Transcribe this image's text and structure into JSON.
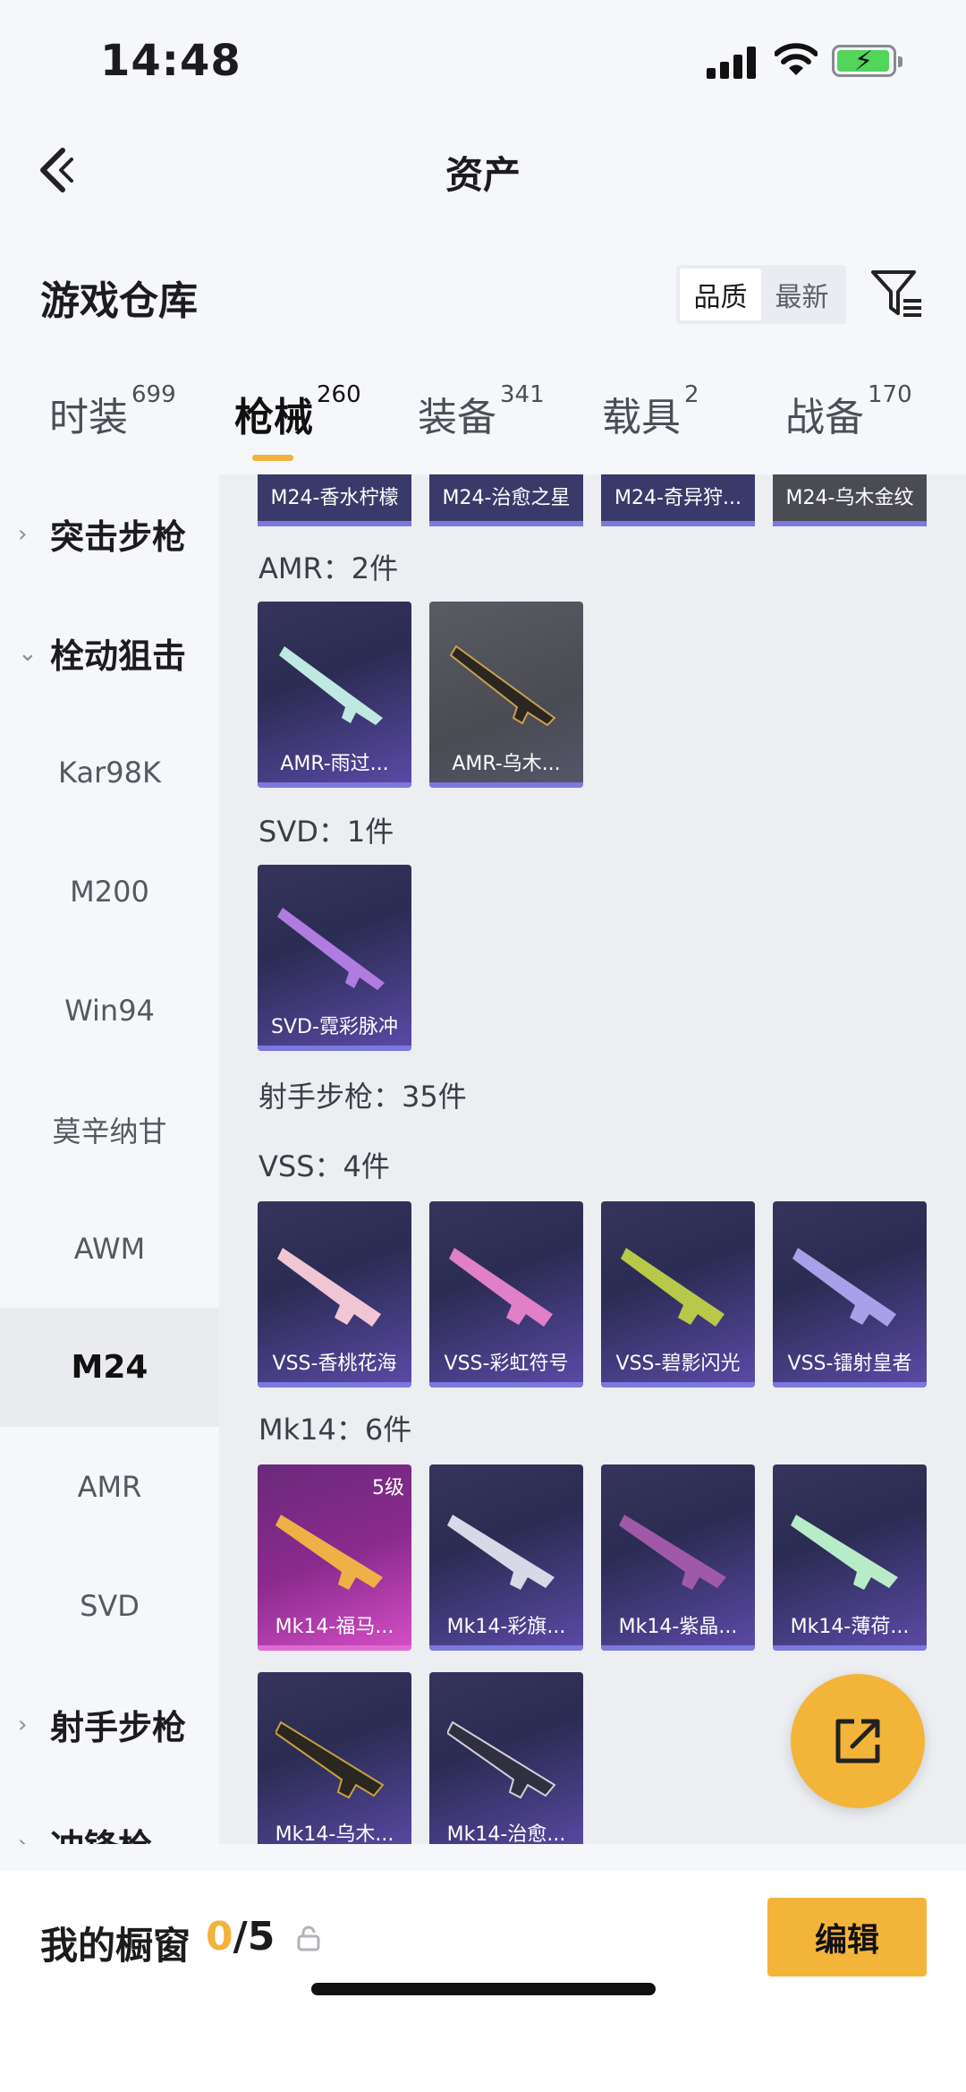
{
  "status_bar": {
    "time": "14:48"
  },
  "nav": {
    "title": "资产"
  },
  "header": {
    "title": "游戏仓库",
    "sort_options": [
      "品质",
      "最新"
    ],
    "sort_active": "品质"
  },
  "tabs": [
    {
      "label": "时装",
      "count": "699"
    },
    {
      "label": "枪械",
      "count": "260",
      "active": true
    },
    {
      "label": "装备",
      "count": "341"
    },
    {
      "label": "载具",
      "count": "2"
    },
    {
      "label": "战备",
      "count": "170"
    }
  ],
  "sidebar": {
    "items": [
      {
        "label": "突击步枪",
        "type": "group",
        "expanded": false
      },
      {
        "label": "栓动狙击",
        "type": "group",
        "expanded": true
      },
      {
        "label": "Kar98K"
      },
      {
        "label": "M200"
      },
      {
        "label": "Win94"
      },
      {
        "label": "莫辛纳甘"
      },
      {
        "label": "AWM"
      },
      {
        "label": "M24",
        "active": true
      },
      {
        "label": "AMR"
      },
      {
        "label": "SVD"
      },
      {
        "label": "射手步枪",
        "type": "group",
        "expanded": false
      },
      {
        "label": "冲锋枪",
        "type": "group",
        "expanded": false
      }
    ]
  },
  "content": {
    "top_row": [
      "M24-香水柠檬",
      "M24-治愈之星",
      "M24-奇异狩...",
      "M24-乌木金纹"
    ],
    "groups": {
      "amr": {
        "label": "AMR：2件",
        "items": [
          "AMR-雨过...",
          "AMR-乌木..."
        ]
      },
      "svd": {
        "label": "SVD：1件",
        "items": [
          "SVD-霓彩脉冲"
        ]
      },
      "dmr": {
        "label": "射手步枪：35件"
      },
      "vss": {
        "label": "VSS：4件",
        "items": [
          "VSS-香桃花海",
          "VSS-彩虹符号",
          "VSS-碧影闪光",
          "VSS-镭射皇者"
        ]
      },
      "mk14": {
        "label": "Mk14：6件",
        "items": [
          "Mk14-福马...",
          "Mk14-彩旗...",
          "Mk14-紫晶...",
          "Mk14-薄荷...",
          "Mk14-乌木...",
          "Mk14-治愈..."
        ],
        "level_badge": "5级"
      }
    }
  },
  "bottom_bar": {
    "label": "我的橱窗",
    "current": "0",
    "total": "/5",
    "edit_label": "编辑"
  },
  "colors": {
    "accent": "#f3b43a",
    "item_bg": "#2f2e57",
    "item_bar": "#7b78e0"
  },
  "icons": [
    "back-arrow-icon",
    "filter-icon",
    "chevron-right-icon",
    "chevron-down-icon",
    "share-icon",
    "lock-icon"
  ]
}
